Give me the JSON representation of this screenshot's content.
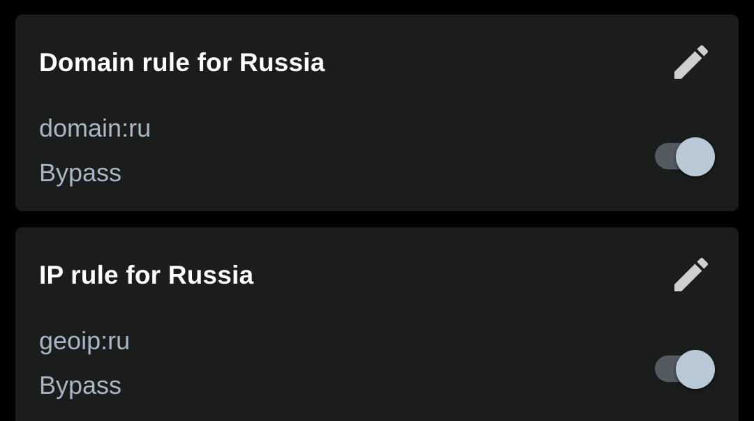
{
  "rules": [
    {
      "title": "Domain rule for Russia",
      "match": "domain:ru",
      "action": "Bypass",
      "enabled": true
    },
    {
      "title": "IP rule for Russia",
      "match": "geoip:ru",
      "action": "Bypass",
      "enabled": true
    }
  ],
  "icons": {
    "edit": "pencil-icon"
  },
  "colors": {
    "background": "#000000",
    "card": "#1b1c1c",
    "title": "#ffffff",
    "secondary_text": "#a9b6c4",
    "switch_track_on": "#535a62",
    "switch_thumb_on": "#b9c9d5",
    "icon": "#cfcfcf"
  }
}
